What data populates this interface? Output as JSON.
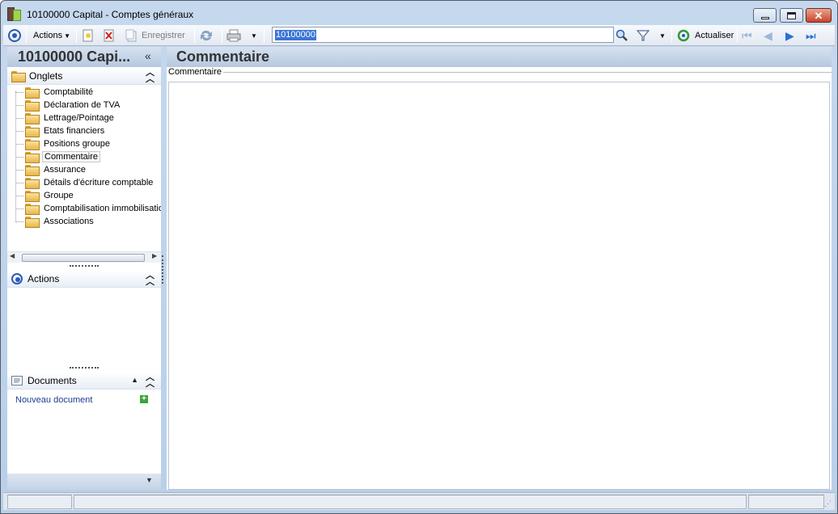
{
  "window": {
    "title": "10100000 Capital -  Comptes généraux"
  },
  "toolbar": {
    "actions_label": "Actions",
    "save_label": "Enregistrer",
    "search_value": "10100000",
    "refresh_label": "Actualiser"
  },
  "left_pane": {
    "title": "10100000 Capi...",
    "collapse_glyph": "«",
    "tabs_section": {
      "label": "Onglets",
      "items": [
        {
          "label": "Comptabilité"
        },
        {
          "label": "Déclaration de TVA"
        },
        {
          "label": "Lettrage/Pointage"
        },
        {
          "label": "Etats financiers"
        },
        {
          "label": "Positions groupe"
        },
        {
          "label": "Commentaire",
          "selected": true
        },
        {
          "label": "Assurance"
        },
        {
          "label": "Détails d'écriture comptable"
        },
        {
          "label": "Groupe"
        },
        {
          "label": "Comptabilisation immobilisations"
        },
        {
          "label": "Associations"
        }
      ]
    },
    "actions_section": {
      "label": "Actions"
    },
    "documents_section": {
      "label": "Documents",
      "new_document_link": "Nouveau document"
    }
  },
  "right_pane": {
    "title": "Commentaire",
    "group_label": "Commentaire",
    "comment_value": ""
  },
  "colors": {
    "accent": "#2a5bb5",
    "header_gradient_top": "#d6e2f0",
    "header_gradient_bottom": "#b6c8df",
    "link": "#1a3f8f"
  }
}
